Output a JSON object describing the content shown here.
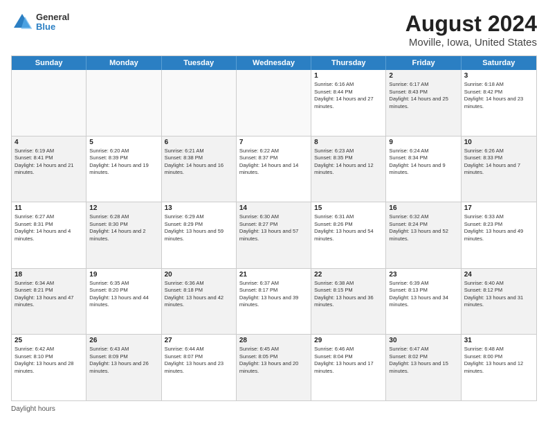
{
  "header": {
    "title": "August 2024",
    "subtitle": "Moville, Iowa, United States"
  },
  "logo": {
    "general": "General",
    "blue": "Blue"
  },
  "days": [
    "Sunday",
    "Monday",
    "Tuesday",
    "Wednesday",
    "Thursday",
    "Friday",
    "Saturday"
  ],
  "footer": {
    "daylight_label": "Daylight hours"
  },
  "weeks": [
    [
      {
        "day": "",
        "text": "",
        "empty": true
      },
      {
        "day": "",
        "text": "",
        "empty": true
      },
      {
        "day": "",
        "text": "",
        "empty": true
      },
      {
        "day": "",
        "text": "",
        "empty": true
      },
      {
        "day": "1",
        "text": "Sunrise: 6:16 AM\nSunset: 8:44 PM\nDaylight: 14 hours and 27 minutes.",
        "empty": false,
        "shaded": false
      },
      {
        "day": "2",
        "text": "Sunrise: 6:17 AM\nSunset: 8:43 PM\nDaylight: 14 hours and 25 minutes.",
        "empty": false,
        "shaded": true
      },
      {
        "day": "3",
        "text": "Sunrise: 6:18 AM\nSunset: 8:42 PM\nDaylight: 14 hours and 23 minutes.",
        "empty": false,
        "shaded": false
      }
    ],
    [
      {
        "day": "4",
        "text": "Sunrise: 6:19 AM\nSunset: 8:41 PM\nDaylight: 14 hours and 21 minutes.",
        "empty": false,
        "shaded": true
      },
      {
        "day": "5",
        "text": "Sunrise: 6:20 AM\nSunset: 8:39 PM\nDaylight: 14 hours and 19 minutes.",
        "empty": false,
        "shaded": false
      },
      {
        "day": "6",
        "text": "Sunrise: 6:21 AM\nSunset: 8:38 PM\nDaylight: 14 hours and 16 minutes.",
        "empty": false,
        "shaded": true
      },
      {
        "day": "7",
        "text": "Sunrise: 6:22 AM\nSunset: 8:37 PM\nDaylight: 14 hours and 14 minutes.",
        "empty": false,
        "shaded": false
      },
      {
        "day": "8",
        "text": "Sunrise: 6:23 AM\nSunset: 8:35 PM\nDaylight: 14 hours and 12 minutes.",
        "empty": false,
        "shaded": true
      },
      {
        "day": "9",
        "text": "Sunrise: 6:24 AM\nSunset: 8:34 PM\nDaylight: 14 hours and 9 minutes.",
        "empty": false,
        "shaded": false
      },
      {
        "day": "10",
        "text": "Sunrise: 6:26 AM\nSunset: 8:33 PM\nDaylight: 14 hours and 7 minutes.",
        "empty": false,
        "shaded": true
      }
    ],
    [
      {
        "day": "11",
        "text": "Sunrise: 6:27 AM\nSunset: 8:31 PM\nDaylight: 14 hours and 4 minutes.",
        "empty": false,
        "shaded": false
      },
      {
        "day": "12",
        "text": "Sunrise: 6:28 AM\nSunset: 8:30 PM\nDaylight: 14 hours and 2 minutes.",
        "empty": false,
        "shaded": true
      },
      {
        "day": "13",
        "text": "Sunrise: 6:29 AM\nSunset: 8:29 PM\nDaylight: 13 hours and 59 minutes.",
        "empty": false,
        "shaded": false
      },
      {
        "day": "14",
        "text": "Sunrise: 6:30 AM\nSunset: 8:27 PM\nDaylight: 13 hours and 57 minutes.",
        "empty": false,
        "shaded": true
      },
      {
        "day": "15",
        "text": "Sunrise: 6:31 AM\nSunset: 8:26 PM\nDaylight: 13 hours and 54 minutes.",
        "empty": false,
        "shaded": false
      },
      {
        "day": "16",
        "text": "Sunrise: 6:32 AM\nSunset: 8:24 PM\nDaylight: 13 hours and 52 minutes.",
        "empty": false,
        "shaded": true
      },
      {
        "day": "17",
        "text": "Sunrise: 6:33 AM\nSunset: 8:23 PM\nDaylight: 13 hours and 49 minutes.",
        "empty": false,
        "shaded": false
      }
    ],
    [
      {
        "day": "18",
        "text": "Sunrise: 6:34 AM\nSunset: 8:21 PM\nDaylight: 13 hours and 47 minutes.",
        "empty": false,
        "shaded": true
      },
      {
        "day": "19",
        "text": "Sunrise: 6:35 AM\nSunset: 8:20 PM\nDaylight: 13 hours and 44 minutes.",
        "empty": false,
        "shaded": false
      },
      {
        "day": "20",
        "text": "Sunrise: 6:36 AM\nSunset: 8:18 PM\nDaylight: 13 hours and 42 minutes.",
        "empty": false,
        "shaded": true
      },
      {
        "day": "21",
        "text": "Sunrise: 6:37 AM\nSunset: 8:17 PM\nDaylight: 13 hours and 39 minutes.",
        "empty": false,
        "shaded": false
      },
      {
        "day": "22",
        "text": "Sunrise: 6:38 AM\nSunset: 8:15 PM\nDaylight: 13 hours and 36 minutes.",
        "empty": false,
        "shaded": true
      },
      {
        "day": "23",
        "text": "Sunrise: 6:39 AM\nSunset: 8:13 PM\nDaylight: 13 hours and 34 minutes.",
        "empty": false,
        "shaded": false
      },
      {
        "day": "24",
        "text": "Sunrise: 6:40 AM\nSunset: 8:12 PM\nDaylight: 13 hours and 31 minutes.",
        "empty": false,
        "shaded": true
      }
    ],
    [
      {
        "day": "25",
        "text": "Sunrise: 6:42 AM\nSunset: 8:10 PM\nDaylight: 13 hours and 28 minutes.",
        "empty": false,
        "shaded": false
      },
      {
        "day": "26",
        "text": "Sunrise: 6:43 AM\nSunset: 8:09 PM\nDaylight: 13 hours and 26 minutes.",
        "empty": false,
        "shaded": true
      },
      {
        "day": "27",
        "text": "Sunrise: 6:44 AM\nSunset: 8:07 PM\nDaylight: 13 hours and 23 minutes.",
        "empty": false,
        "shaded": false
      },
      {
        "day": "28",
        "text": "Sunrise: 6:45 AM\nSunset: 8:05 PM\nDaylight: 13 hours and 20 minutes.",
        "empty": false,
        "shaded": true
      },
      {
        "day": "29",
        "text": "Sunrise: 6:46 AM\nSunset: 8:04 PM\nDaylight: 13 hours and 17 minutes.",
        "empty": false,
        "shaded": false
      },
      {
        "day": "30",
        "text": "Sunrise: 6:47 AM\nSunset: 8:02 PM\nDaylight: 13 hours and 15 minutes.",
        "empty": false,
        "shaded": true
      },
      {
        "day": "31",
        "text": "Sunrise: 6:48 AM\nSunset: 8:00 PM\nDaylight: 13 hours and 12 minutes.",
        "empty": false,
        "shaded": false
      }
    ]
  ]
}
